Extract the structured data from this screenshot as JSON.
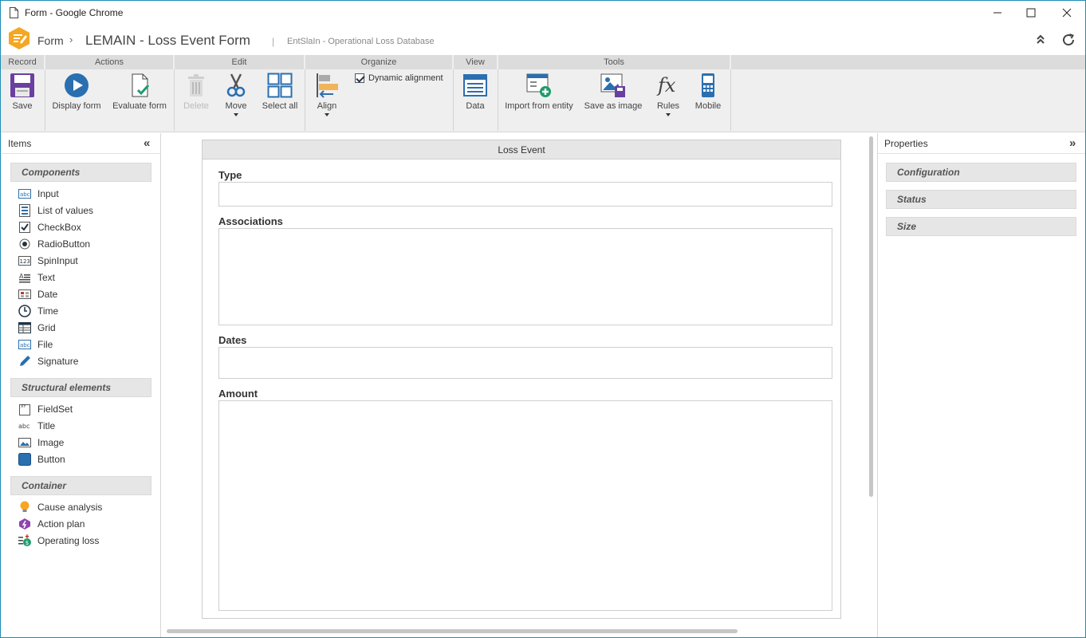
{
  "window": {
    "title": "Form - Google Chrome"
  },
  "header": {
    "breadcrumb_root": "Form",
    "breadcrumb_sep": "›",
    "form_title": "LEMAIN - Loss Event Form",
    "divider": "|",
    "subtitle": "EntSlaIn - Operational Loss Database"
  },
  "ribbon": {
    "groups": {
      "record": "Record",
      "actions": "Actions",
      "edit": "Edit",
      "organize": "Organize",
      "view": "View",
      "tools": "Tools"
    },
    "buttons": {
      "save": "Save",
      "display_form": "Display form",
      "evaluate_form": "Evaluate form",
      "delete": "Delete",
      "move": "Move",
      "select_all": "Select all",
      "align": "Align",
      "dynamic_alignment": "Dynamic alignment",
      "data": "Data",
      "import_from_entity": "Import from entity",
      "save_as_image": "Save as image",
      "rules": "Rules",
      "mobile": "Mobile"
    },
    "dynamic_alignment_checked": true
  },
  "items_panel": {
    "title": "Items",
    "collapse_glyph": "«",
    "sections": [
      {
        "title": "Components",
        "items": [
          "Input",
          "List of values",
          "CheckBox",
          "RadioButton",
          "SpinInput",
          "Text",
          "Date",
          "Time",
          "Grid",
          "File",
          "Signature"
        ]
      },
      {
        "title": "Structural elements",
        "items": [
          "FieldSet",
          "Title",
          "Image",
          "Button"
        ]
      },
      {
        "title": "Container",
        "items": [
          "Cause analysis",
          "Action plan",
          "Operating loss"
        ]
      }
    ]
  },
  "canvas": {
    "fieldset_title": "Loss Event",
    "fields": [
      "Type",
      "Associations",
      "Dates",
      "Amount"
    ]
  },
  "properties_panel": {
    "title": "Properties",
    "expand_glyph": "»",
    "sections": [
      "Configuration",
      "Status",
      "Size"
    ]
  },
  "colors": {
    "accent_blue": "#2a6fb0",
    "save_purple": "#6b3fa0",
    "logo_orange": "#f5a623"
  }
}
